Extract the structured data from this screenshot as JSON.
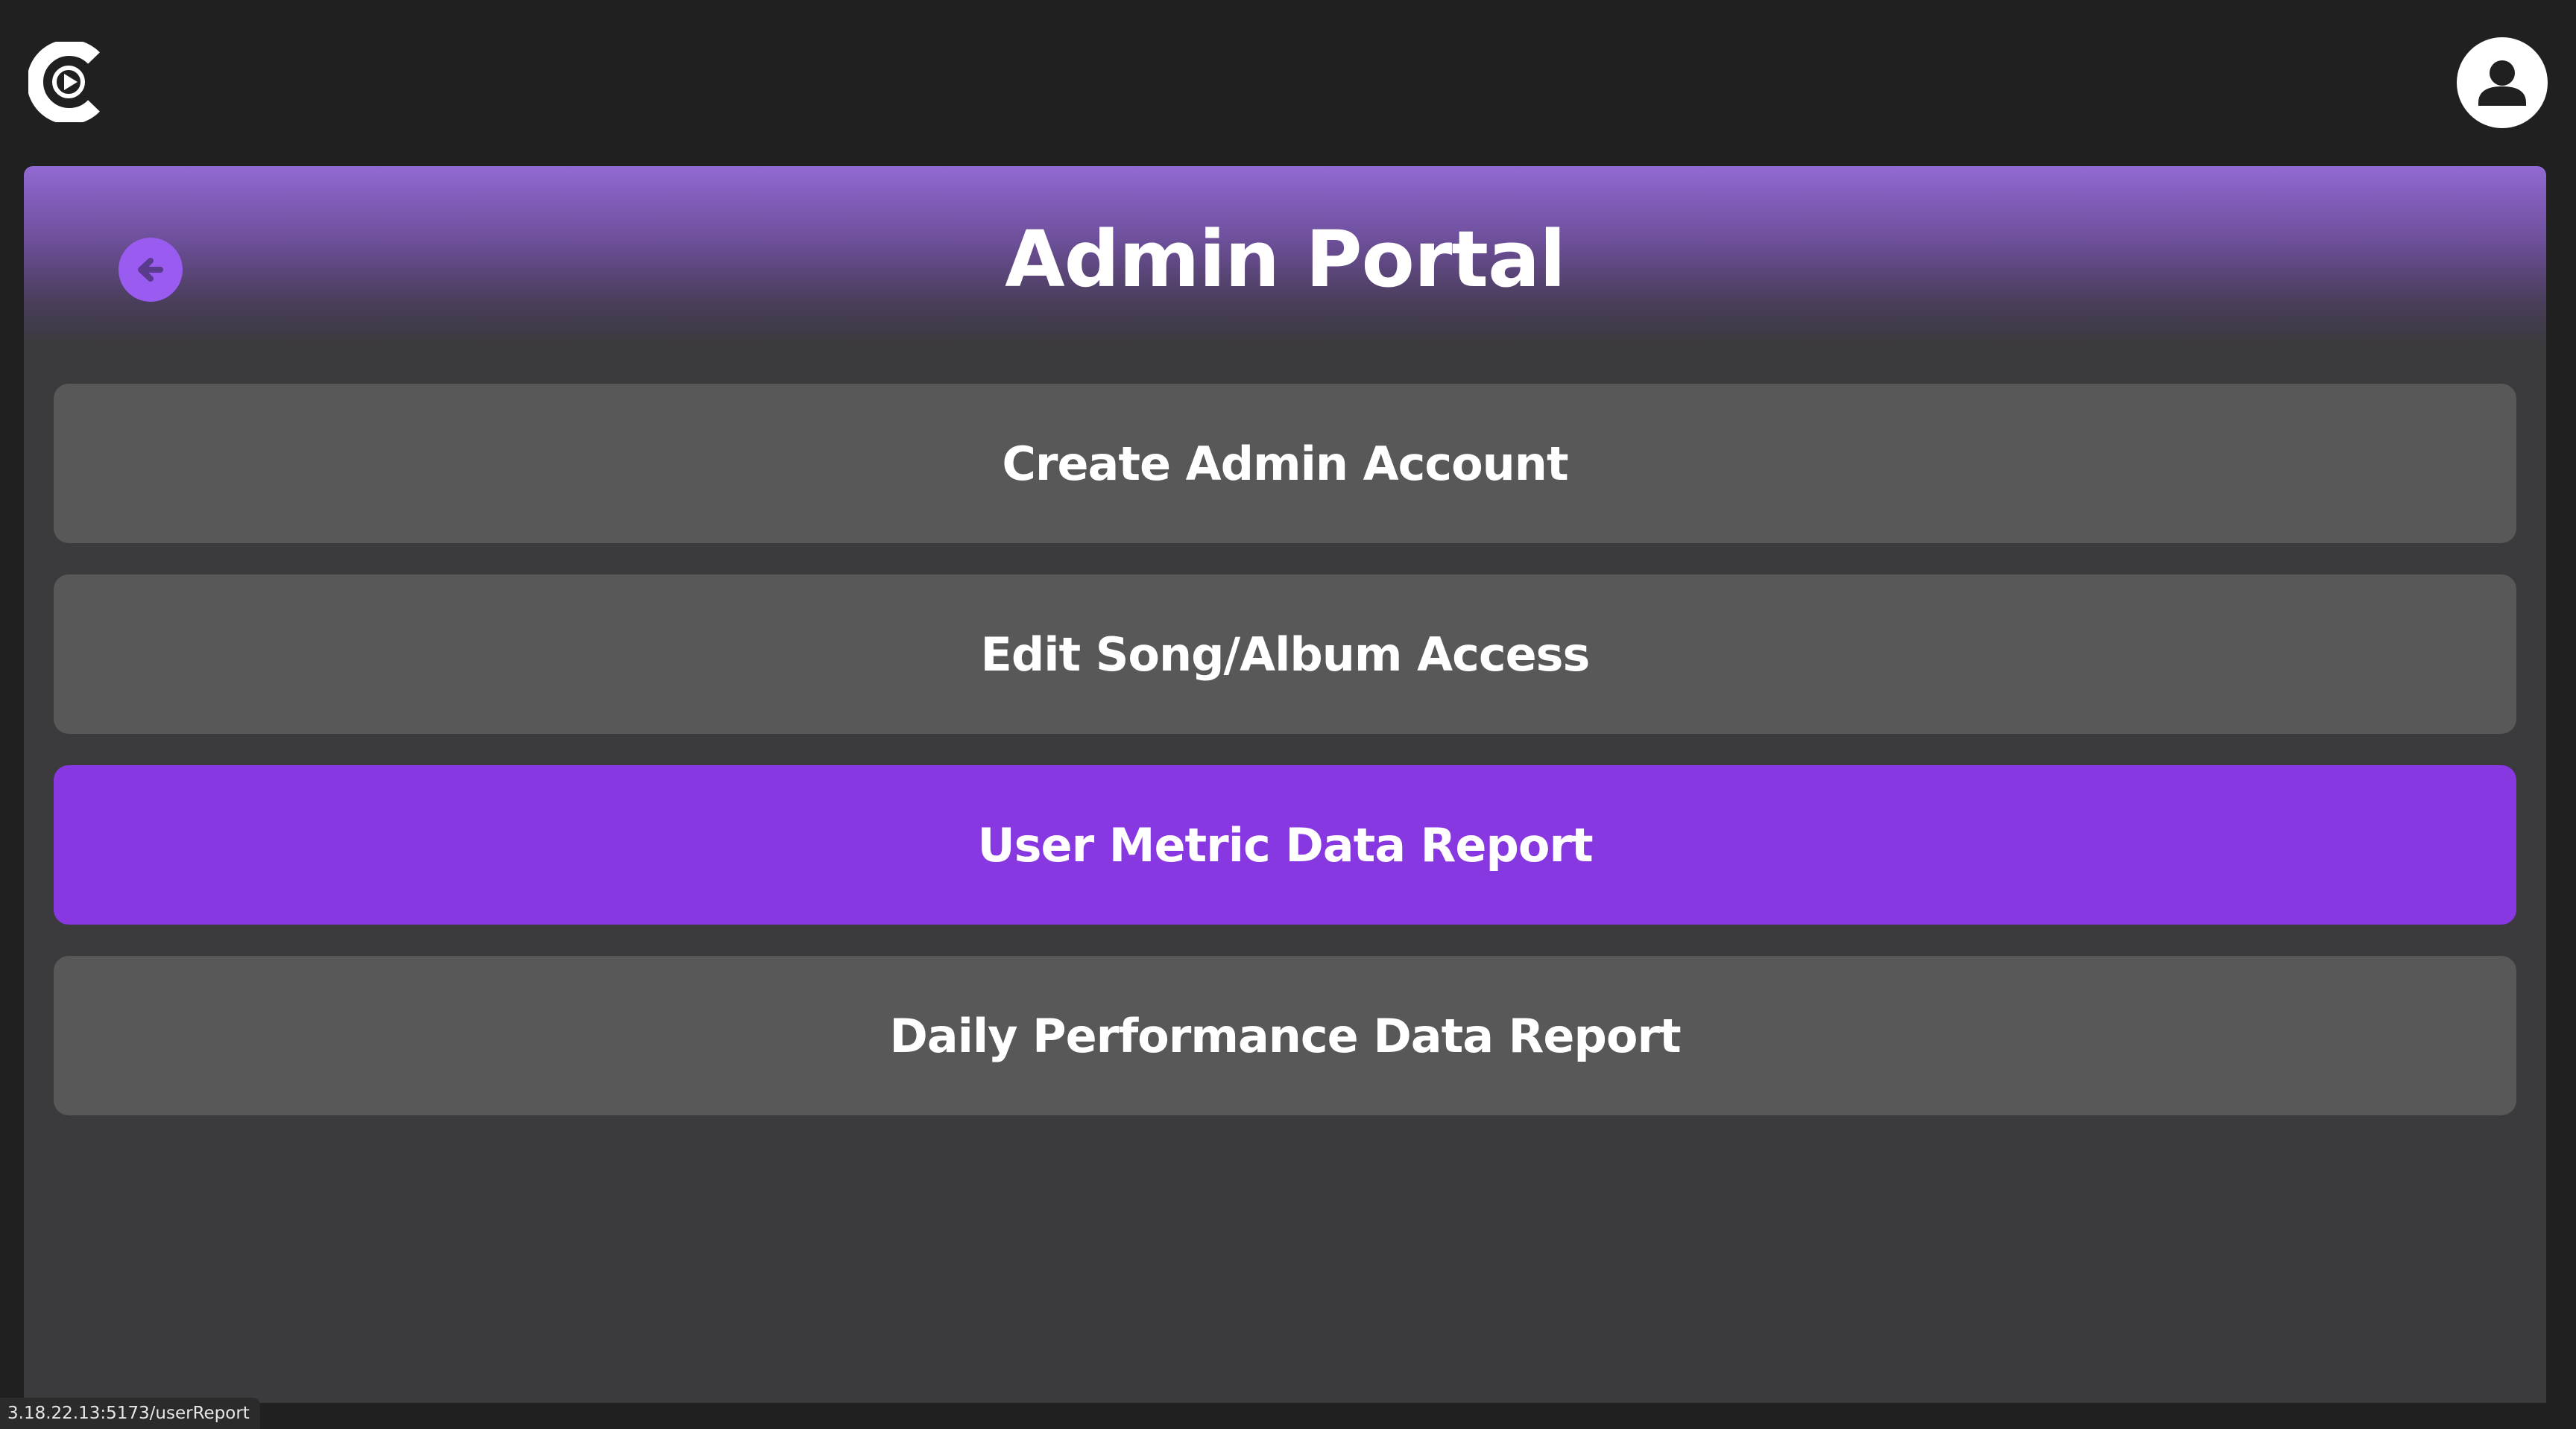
{
  "header": {
    "logo_icon": "play-circle-c-logo-icon",
    "profile_icon": "user-avatar-icon"
  },
  "panel": {
    "title": "Admin Portal",
    "back_icon": "arrow-left-icon",
    "accent_color": "#8838e0",
    "menu": [
      {
        "label": "Create Admin Account",
        "active": false
      },
      {
        "label": "Edit Song/Album Access",
        "active": false
      },
      {
        "label": "User Metric Data Report",
        "active": true
      },
      {
        "label": "Daily Performance Data Report",
        "active": false
      }
    ]
  },
  "status_bar": {
    "url": "3.18.22.13:5173/userReport"
  }
}
